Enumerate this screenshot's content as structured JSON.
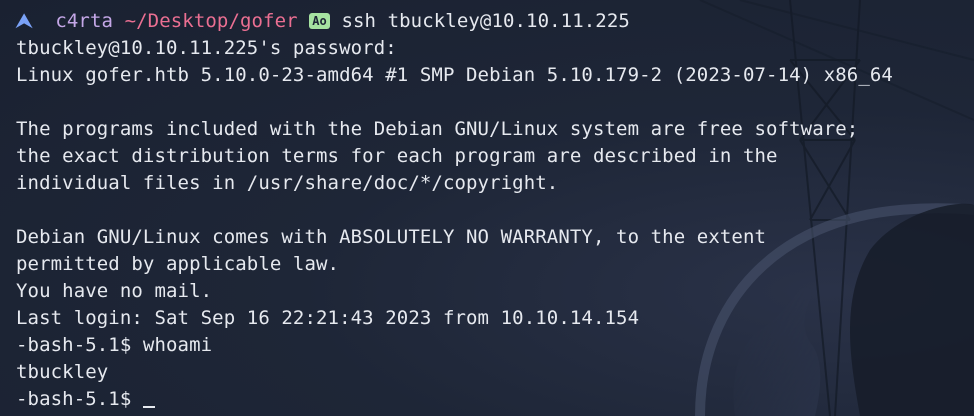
{
  "prompt": {
    "user": "c4rta",
    "path": "~/Desktop/gofer",
    "command": "ssh tbuckley@10.10.11.225",
    "arrow_icon": "arrow-up-icon",
    "git_icon": "git-status-icon",
    "git_label": "Ao"
  },
  "output": {
    "line1": "tbuckley@10.10.11.225's password:",
    "line2": "Linux gofer.htb 5.10.0-23-amd64 #1 SMP Debian 5.10.179-2 (2023-07-14) x86_64",
    "line3": "",
    "line4": "The programs included with the Debian GNU/Linux system are free software;",
    "line5": "the exact distribution terms for each program are described in the",
    "line6": "individual files in /usr/share/doc/*/copyright.",
    "line7": "",
    "line8": "Debian GNU/Linux comes with ABSOLUTELY NO WARRANTY, to the extent",
    "line9": "permitted by applicable law.",
    "line10": "You have no mail.",
    "line11": "Last login: Sat Sep 16 22:21:43 2023 from 10.10.14.154",
    "line12": "-bash-5.1$ whoami",
    "line13": "tbuckley",
    "line14": "-bash-5.1$ "
  },
  "colors": {
    "background": "#1c2434",
    "foreground": "#e6e9ef",
    "user": "#c4a7e7",
    "path": "#eb6f92",
    "arrow": "#7aa2f7",
    "git_badge": "#a6e3a1"
  }
}
